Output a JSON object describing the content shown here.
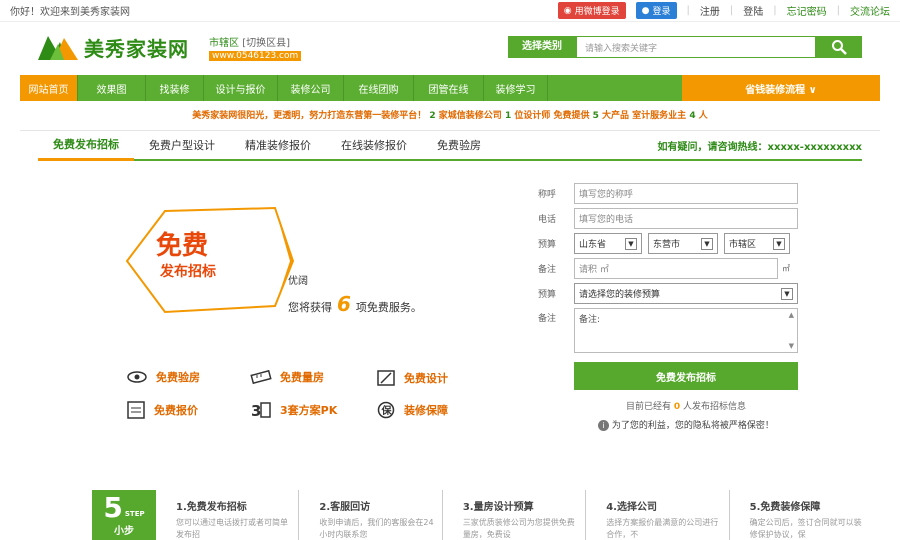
{
  "topbar": {
    "welcome": "你好！欢迎来到美秀家装网",
    "weibo_login": "用微博登录",
    "qq_login": "登录",
    "register": "注册",
    "login": "登陆",
    "forgot": "忘记密码",
    "forum": "交流论坛"
  },
  "header": {
    "logo_text": "美秀家装网",
    "city": "市辖区",
    "switch_city": "[切换区县]",
    "url": "www.0546123.com",
    "search_label": "选择类别",
    "search_placeholder": "请输入搜索关键字"
  },
  "nav": {
    "items": [
      "网站首页",
      "效果图",
      "找装修",
      "设计与报价",
      "装修公司",
      "在线团购",
      "团管在线",
      "装修学习"
    ],
    "process": "省钱装修流程 ∨"
  },
  "notice": {
    "part1": "美秀家装网很阳光，更透明，努力打造东营第一装修平台！",
    "n1": "2",
    "part2": "家城信装修公司",
    "n2": "1",
    "part3": "位设计师 免费提供",
    "n3": "5",
    "part4": "大产品 室计服务业主",
    "n4": "4",
    "part5": "人"
  },
  "tabs": {
    "items": [
      "免费发布招标",
      "免费户型设计",
      "精准装修报价",
      "在线装修报价",
      "免费验房"
    ],
    "hotline": "如有疑问，请咨询热线：xxxxx-xxxxxxxxx"
  },
  "promo": {
    "badge_line1": "免费",
    "badge_line2": "发布招标",
    "gift": "优阔",
    "get_prefix": "您将获得",
    "count": "6",
    "get_suffix": "项免费服务。"
  },
  "features": [
    {
      "label": "免费验房",
      "icon": "eye-icon"
    },
    {
      "label": "免费量房",
      "icon": "ruler-icon"
    },
    {
      "label": "免费设计",
      "icon": "pencil-icon"
    },
    {
      "label": "免费报价",
      "icon": "list-icon"
    },
    {
      "label": "3套方案PK",
      "icon": "three-plans-icon"
    },
    {
      "label": "装修保障",
      "icon": "shield-icon"
    }
  ],
  "form": {
    "name_label": "称呼",
    "name_placeholder": "填写您的称呼",
    "phone_label": "电话",
    "phone_placeholder": "填写您的电话",
    "region_label": "预算",
    "province": "山东省",
    "city": "东营市",
    "district": "市辖区",
    "area_label": "备注",
    "area_placeholder": "请积 ㎡",
    "area_unit": "㎡",
    "budget_label": "预算",
    "budget_value": "请选择您的装修预算",
    "note_label": "备注",
    "note_value": "备注:",
    "submit": "免费发布招标",
    "count_prefix": "目前已经有",
    "count_num": "0",
    "count_suffix": "人发布招标信息",
    "privacy": "为了您的利益，您的隐私将被严格保密！"
  },
  "steps": {
    "badge_num": "5",
    "badge_step": "STEP",
    "badge_label": "小步",
    "items": [
      {
        "title": "1.免费发布招标",
        "desc": "您可以通过电话拨打或者可简单发布招"
      },
      {
        "title": "2.客服回访",
        "desc": "收到申请后，我们的客服会在24小时内联系您"
      },
      {
        "title": "3.量房设计预算",
        "desc": "三家优质装修公司为您提供免费量房，免费设"
      },
      {
        "title": "4.选择公司",
        "desc": "选择方案报价最满意的公司进行合作，不"
      },
      {
        "title": "5.免费装修保障",
        "desc": "确定公司后，签订合同就可以装修保护协议，保"
      }
    ]
  },
  "colors": {
    "green": "#57a92e",
    "orange": "#f39800"
  }
}
